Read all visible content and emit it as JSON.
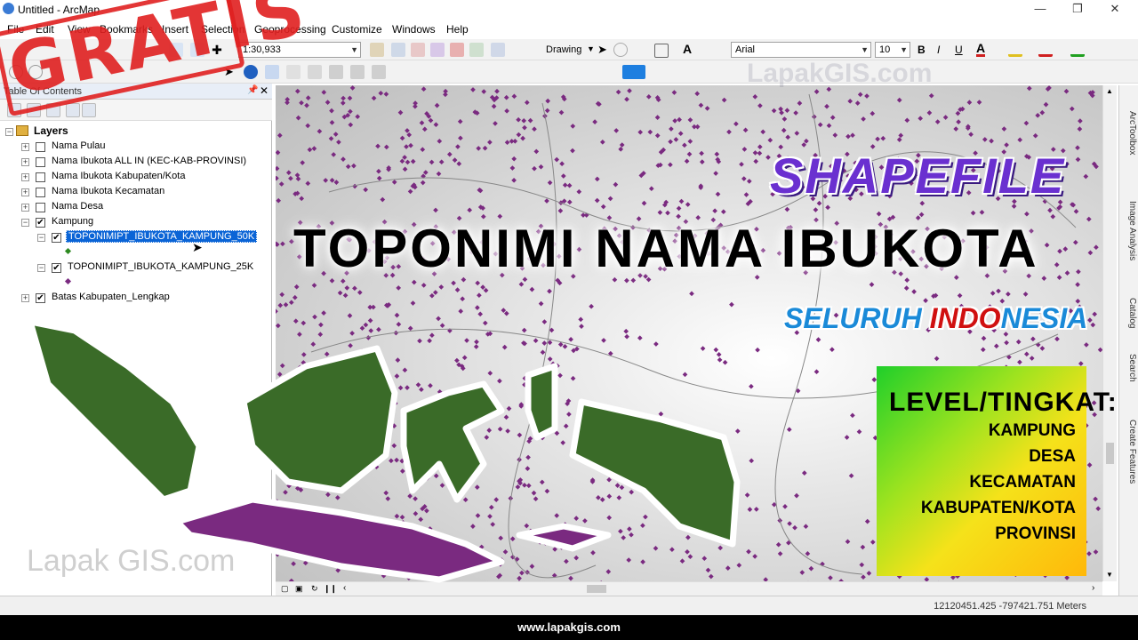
{
  "window": {
    "title": "Untitled - ArcMap",
    "controls": [
      "—",
      "❐",
      "✕"
    ]
  },
  "menu": [
    "File",
    "Edit",
    "View",
    "Bookmarks",
    "Insert",
    "Selection",
    "Geoprocessing",
    "Customize",
    "Windows",
    "Help"
  ],
  "toolbar": {
    "scale_value": "1:30,933",
    "drawing_label": "Drawing",
    "font_name": "Arial",
    "font_size": "10",
    "bold": "B",
    "italic": "I",
    "underline": "U",
    "text_tool": "A"
  },
  "toc": {
    "title": "Table Of Contents",
    "root": "Layers",
    "layers": [
      {
        "name": "Nama Pulau",
        "checked": false,
        "expanded": false
      },
      {
        "name": "Nama Ibukota ALL IN (KEC-KAB-PROVINSI)",
        "checked": false,
        "expanded": false
      },
      {
        "name": "Nama Ibukota Kabupaten/Kota",
        "checked": false,
        "expanded": false
      },
      {
        "name": "Nama Ibukota Kecamatan",
        "checked": false,
        "expanded": false
      },
      {
        "name": "Nama Desa",
        "checked": false,
        "expanded": false
      },
      {
        "name": "Kampung",
        "checked": true,
        "expanded": true
      },
      {
        "name": "TOPONIMIPT_IBUKOTA_KAMPUNG_50K",
        "checked": true,
        "expanded": true,
        "selected": true
      },
      {
        "name": "TOPONIMIPT_IBUKOTA_KAMPUNG_25K",
        "checked": true,
        "expanded": true
      },
      {
        "name": "Batas Kabupaten_Lengkap",
        "checked": true,
        "expanded": false
      }
    ]
  },
  "overlay": {
    "stamp": "GRATIS",
    "shapefile": "SHAPEFILE",
    "headline": "TOPONIMI NAMA IBUKOTA",
    "seluruh_part1": "SELURUH ",
    "seluruh_part2": "INDO",
    "seluruh_part3": "NESIA",
    "level_title": "LEVEL/TINGKAT:",
    "levels": [
      "KAMPUNG",
      "DESA",
      "KECAMATAN",
      "KABUPATEN/KOTA",
      "PROVINSI"
    ],
    "brand": "Lapak GIS.com",
    "watermark": "LapakGIS.com"
  },
  "dock_tabs": [
    "ArcToolbox",
    "Image Analysis",
    "Catalog",
    "Search",
    "Create Features"
  ],
  "status": {
    "coordinates": "12120451.425  -797421.751 Meters"
  },
  "footer": {
    "url": "www.lapakgis.com"
  },
  "colors": {
    "dots": "#7a2a80",
    "land_green": "#2d6b1e",
    "selection": "#0a64d6",
    "stamp": "#e02020"
  }
}
